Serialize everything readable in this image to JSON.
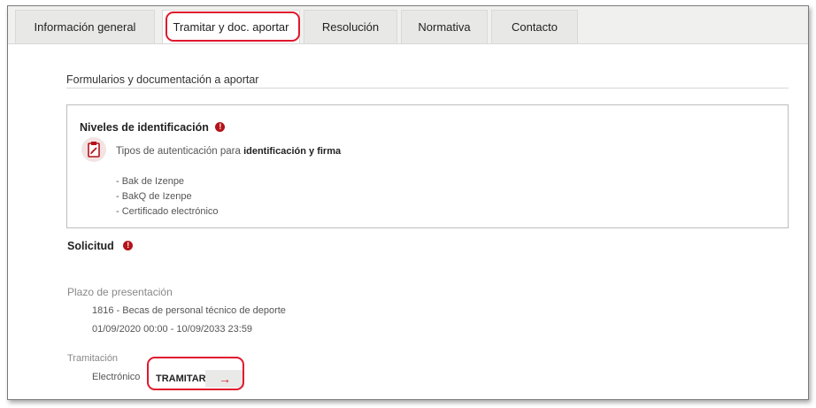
{
  "tabs": [
    {
      "label": "Información general"
    },
    {
      "label": "Tramitar y doc. aportar"
    },
    {
      "label": "Resolución"
    },
    {
      "label": "Normativa"
    },
    {
      "label": "Contacto"
    }
  ],
  "section": {
    "title": "Formularios y documentación a aportar"
  },
  "identification": {
    "title": "Niveles de identificación",
    "info_glyph": "!",
    "auth_text_prefix": "Tipos de autenticación para ",
    "auth_text_bold": "identificación y firma",
    "methods": [
      "- Bak de Izenpe",
      "- BakQ de Izenpe",
      "- Certificado electrónico"
    ]
  },
  "solicitud": {
    "title": "Solicitud",
    "info_glyph": "!"
  },
  "plazo": {
    "label": "Plazo de presentación",
    "item": "1816 - Becas de personal técnico de deporte",
    "dates": "01/09/2020 00:00 - 10/09/2033 23:59"
  },
  "tramitacion": {
    "label": "Tramitación",
    "channel": "Electrónico",
    "button_label": "TRAMITAR",
    "arrow": "→"
  },
  "colors": {
    "highlight": "#e0182d",
    "accent": "#b3131a"
  }
}
